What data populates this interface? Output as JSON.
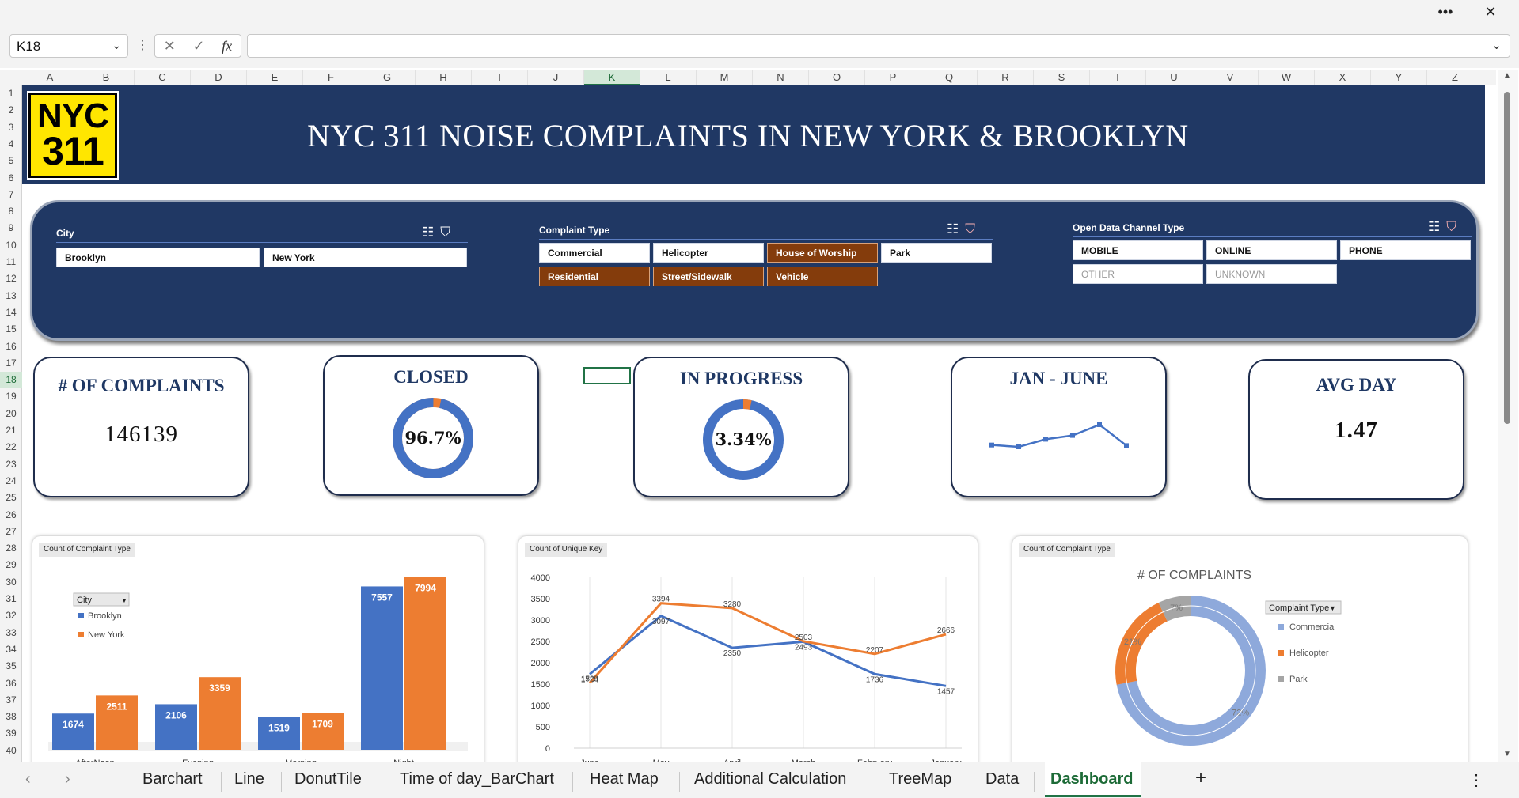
{
  "window": {
    "more_icon": "more-icon",
    "close_icon": "close-icon"
  },
  "formula": {
    "name_box": "K18",
    "fx": "fx"
  },
  "columns": [
    "A",
    "B",
    "C",
    "D",
    "E",
    "F",
    "G",
    "H",
    "I",
    "J",
    "K",
    "L",
    "M",
    "N",
    "O",
    "P",
    "Q",
    "R",
    "S",
    "T",
    "U",
    "V",
    "W",
    "X",
    "Y",
    "Z"
  ],
  "active_column": "K",
  "rows": [
    "1",
    "2",
    "3",
    "4",
    "5",
    "6",
    "7",
    "8",
    "9",
    "10",
    "11",
    "12",
    "13",
    "14",
    "15",
    "16",
    "17",
    "18",
    "19",
    "20",
    "21",
    "22",
    "23",
    "24",
    "25",
    "26",
    "27",
    "28",
    "29",
    "30",
    "31",
    "32",
    "33",
    "34",
    "35",
    "36",
    "37",
    "38",
    "39",
    "40"
  ],
  "active_row": "18",
  "logo": {
    "line1": "NYC",
    "line2": "311"
  },
  "banner": {
    "title": "NYC 311 NOISE COMPLAINTS IN NEW YORK & BROOKLYN"
  },
  "slicers": {
    "city": {
      "title": "City",
      "items": [
        {
          "label": "Brooklyn",
          "state": "on"
        },
        {
          "label": "New York",
          "state": "on"
        }
      ]
    },
    "complaint": {
      "title": "Complaint Type",
      "items": [
        {
          "label": "Commercial",
          "state": "on"
        },
        {
          "label": "Helicopter",
          "state": "on"
        },
        {
          "label": "House of Worship",
          "state": "sel"
        },
        {
          "label": "Park",
          "state": "on"
        },
        {
          "label": "Residential",
          "state": "sel"
        },
        {
          "label": "Street/Sidewalk",
          "state": "sel"
        },
        {
          "label": "Vehicle",
          "state": "sel"
        }
      ]
    },
    "channel": {
      "title": "Open Data Channel Type",
      "items": [
        {
          "label": "MOBILE",
          "state": "on"
        },
        {
          "label": "ONLINE",
          "state": "on"
        },
        {
          "label": "PHONE",
          "state": "on"
        },
        {
          "label": "OTHER",
          "state": "off"
        },
        {
          "label": "UNKNOWN",
          "state": "off"
        }
      ]
    }
  },
  "kpis": {
    "complaints": {
      "title": "# OF COMPLAINTS",
      "value": "146139"
    },
    "closed": {
      "title": "CLOSED",
      "value": "96.7%",
      "fraction": 0.967,
      "ring_color": "#4472c4",
      "rest_color": "#ed7d31"
    },
    "inprogress": {
      "title": "IN PROGRESS",
      "value": "3.34%",
      "fraction": 0.0334,
      "ring_color": "#ed7d31",
      "rest_color": "#4472c4"
    },
    "janjune": {
      "title": "JAN - JUNE",
      "spark": [
        1529,
        1500,
        1620,
        1680,
        1850,
        1520
      ]
    },
    "avgday": {
      "title": "AVG DAY",
      "value": "1.47"
    }
  },
  "colors": {
    "blue": "#4472c4",
    "orange": "#ed7d31",
    "gray": "#a5a5a5",
    "light_blue": "#8ea9db",
    "navy": "#203864"
  },
  "chart_data": [
    {
      "type": "bar",
      "tag": "Count of Complaint Type",
      "legend_title": "City",
      "categories": [
        "AfterNoon",
        "Evening",
        "Morning",
        "Night"
      ],
      "series": [
        {
          "name": "Brooklyn",
          "values": [
            1674,
            2106,
            1519,
            7557
          ]
        },
        {
          "name": "New York",
          "values": [
            2511,
            3359,
            1709,
            7994
          ]
        }
      ],
      "ylim": [
        0,
        9000
      ]
    },
    {
      "type": "line",
      "tag": "Count of Unique Key",
      "categories": [
        "June",
        "May",
        "April",
        "March",
        "February",
        "January"
      ],
      "series": [
        {
          "name": "Brooklyn",
          "values": [
            1734,
            3097,
            2350,
            2493,
            1736,
            1457
          ]
        },
        {
          "name": "New York",
          "values": [
            1529,
            3394,
            3280,
            2503,
            2207,
            2666
          ]
        }
      ],
      "yticks": [
        0,
        500,
        1000,
        1500,
        2000,
        2500,
        3000,
        3500,
        4000
      ],
      "ylim": [
        0,
        4000
      ]
    },
    {
      "type": "pie",
      "tag": "Count of Complaint Type",
      "title": "# OF COMPLAINTS",
      "legend_title": "Complaint Type",
      "slices": [
        {
          "label": "Commercial",
          "value": 72,
          "display": "72%"
        },
        {
          "label": "Helicopter",
          "value": 21,
          "display": "21%"
        },
        {
          "label": "Park",
          "value": 7,
          "display": "7%"
        }
      ]
    }
  ],
  "tabs": [
    "Barchart",
    "Line",
    "DonutTile",
    "Time of day_BarChart",
    "Heat Map",
    "Additional Calculation",
    "TreeMap",
    "Data",
    "Dashboard"
  ],
  "active_tab": "Dashboard",
  "tabbar": {
    "add": "+",
    "more": "⋮"
  }
}
